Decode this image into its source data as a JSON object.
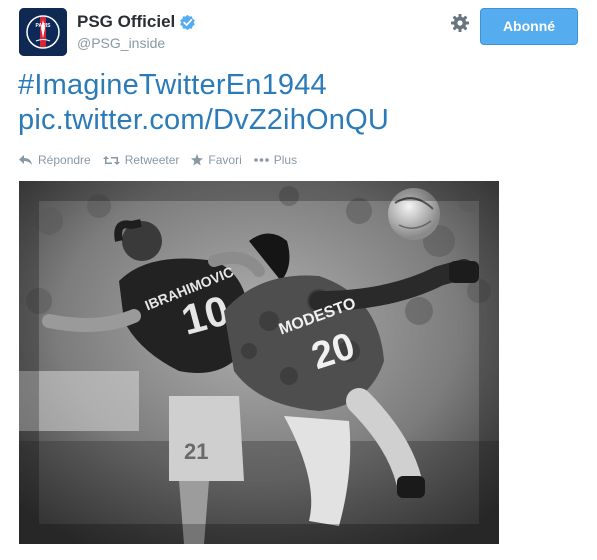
{
  "account": {
    "name": "PSG Officiel",
    "handle": "@PSG_inside",
    "avatar_text": "PARIS"
  },
  "follow_button": {
    "label": "Abonné"
  },
  "tweet": {
    "hashtag": "#ImagineTwitterEn1944",
    "link": "pic.twitter.com/DvZ2ihOnQU"
  },
  "actions": {
    "reply": "Répondre",
    "retweet": "Retweeter",
    "favorite": "Favori",
    "more": "Plus"
  },
  "photo": {
    "jersey_left_name": "IBRAHIMOVIC",
    "jersey_left_number": "10",
    "jersey_right_name": "MODESTO",
    "jersey_right_number": "20",
    "jersey_back_number": "21"
  },
  "colors": {
    "accent": "#55acee",
    "link": "#2b7bb9",
    "muted": "#8899a6"
  }
}
